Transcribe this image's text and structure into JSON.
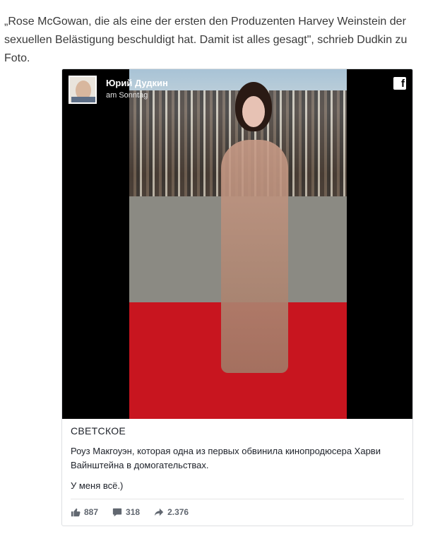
{
  "article": {
    "text": "„Rose McGowan, die als eine der ersten den Produzenten Harvey Weinstein der sexuellen Belästigung beschuldigt hat. Damit ist alles gesagt\", schrieb Dudkin zu Foto."
  },
  "post": {
    "author": "Юрий Дудкин",
    "timestamp": "am Sonntag",
    "category": "СВЕТСКОЕ",
    "description": "Роуз Макгоуэн, которая одна из первых обвинила кинопродюсера Харви Вайнштейна в домогательствах.",
    "note": "У меня всё.)",
    "stats": {
      "likes": "887",
      "comments": "318",
      "shares": "2.376"
    },
    "icons": {
      "logo": "facebook-icon",
      "like": "thumbs-up-icon",
      "comment": "comment-icon",
      "share": "share-arrow-icon"
    }
  }
}
